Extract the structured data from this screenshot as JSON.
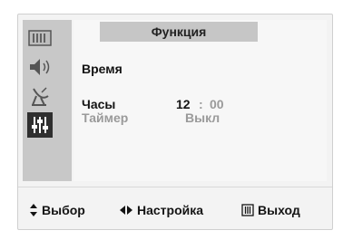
{
  "menu": {
    "title": "Функция",
    "section_label": "Время",
    "items": [
      {
        "label": "Часы",
        "value_hours": "12",
        "value_sep": ":",
        "value_minutes": "00"
      },
      {
        "label": "Таймер",
        "value": "Выкл"
      }
    ]
  },
  "sidebar": {
    "icons": [
      "picture-icon",
      "sound-icon",
      "channel-icon",
      "function-icon"
    ],
    "active": "function-icon"
  },
  "footer": {
    "select_label": "Выбор",
    "adjust_label": "Настройка",
    "exit_label": "Выход"
  },
  "colors": {
    "background": "#f3f3f3",
    "sidebar": "#c8c8c8",
    "header_bar": "#c6c6c6",
    "active_icon_bg": "#2f2f2f",
    "text": "#141414",
    "disabled_text": "#9a9a9a"
  }
}
